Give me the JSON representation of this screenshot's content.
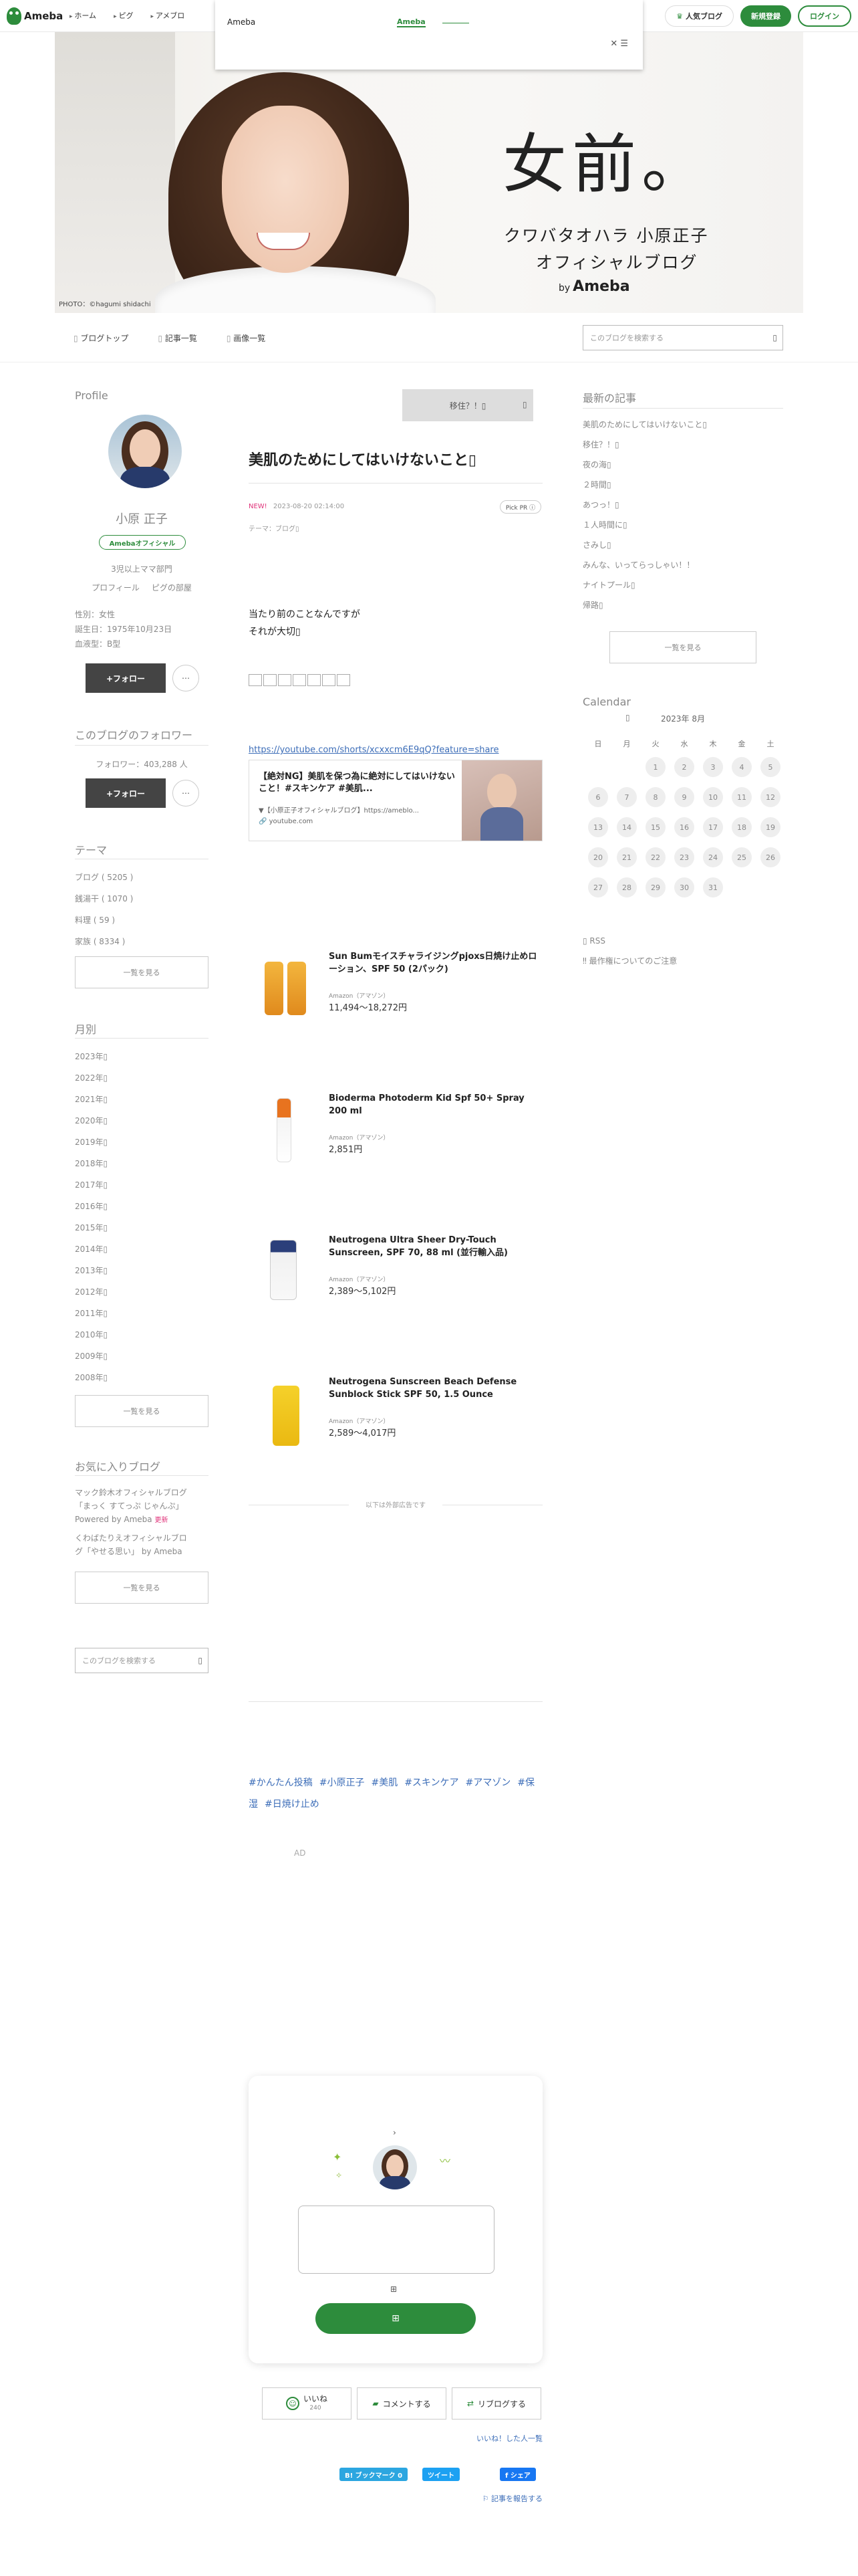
{
  "header": {
    "logo": "Ameba",
    "nav": [
      "ホーム",
      "ピグ",
      "アメブロ"
    ],
    "dropdown_brand": "Ameba",
    "dropdown_tab": "Ameba",
    "close_label": "✕ ☰",
    "popular_blog": "人気ブログ",
    "register": "新規登録",
    "login": "ログイン"
  },
  "hero": {
    "title": "女前。",
    "subtitle1": "クワバタオハラ 小原正子",
    "subtitle2": "オフィシャルブログ",
    "by": "by",
    "by_brand": "Ameba",
    "credit": "PHOTO：©hagumi shidachi"
  },
  "subnav": {
    "items": [
      "ブログトップ",
      "記事一覧",
      "画像一覧"
    ],
    "search_placeholder": "このブログを検索する"
  },
  "profile": {
    "heading": "Profile",
    "name": "小原 正子",
    "badge": "Amebaオフィシャル",
    "rank": "3児以上ママ部門",
    "links": [
      "プロフィール",
      "ピグの部屋"
    ],
    "details": [
      "性別：女性",
      "誕生日：1975年10月23日",
      "血液型：B型"
    ],
    "follow": "+フォロー",
    "dots": "⋯"
  },
  "followers": {
    "heading": "このブログのフォロワー",
    "count_text": "フォロワー：403,288 人",
    "follow": "+フォロー",
    "dots": "⋯"
  },
  "themes": {
    "heading": "テーマ",
    "items": [
      "ブログ ( 5205 )",
      "銭湯干 ( 1070 )",
      "料理 ( 59 )",
      "家族 ( 8334 )"
    ],
    "more": "一覧を見る"
  },
  "monthly": {
    "heading": "月別",
    "items": [
      "2023年▯",
      "2022年▯",
      "2021年▯",
      "2020年▯",
      "2019年▯",
      "2018年▯",
      "2017年▯",
      "2016年▯",
      "2015年▯",
      "2014年▯",
      "2013年▯",
      "2012年▯",
      "2011年▯",
      "2010年▯",
      "2009年▯",
      "2008年▯"
    ],
    "more": "一覧を見る"
  },
  "favorites": {
    "heading": "お気に入りブログ",
    "item1_line1": "マック鈴木オフィシャルブログ",
    "item1_line2": "「まっく すてっぷ じゃんぷ」",
    "item1_line3": "Powered by Ameba",
    "item1_new": "更新",
    "item2_line1": "くわばたりえオフィシャルブロ",
    "item2_line2": "グ「やせる思い」 by Ameba",
    "more": "一覧を見る",
    "search_placeholder": "このブログを検索する"
  },
  "article": {
    "next_label": "移住？！▯",
    "title": "美肌のためにしてはいけないこと▯",
    "new_badge": "NEW!",
    "date": "2023-08-20 02:14:00",
    "theme": "テーマ：ブログ▯",
    "pick": "Pick PR ⓘ",
    "body_line1": "当たり前のことなんですが",
    "body_line2": "それが大切▯",
    "link": "https://youtube.com/shorts/xcxxcm6E9qQ?feature=share",
    "embed_title": "【絶対NG】美肌を保つ為に絶対にしてはいけないこと！#スキンケア #美肌...",
    "embed_channel": "▼【小原正子オフィシャルブログ】https://ameblo...",
    "embed_domain": "🔗 youtube.com",
    "ads_label": "以下は外部広告です",
    "ad_text": "AD",
    "hashtags": [
      "#かんたん投稿",
      "#小原正子",
      "#美肌",
      "#スキンケア",
      "#アマゾン",
      "#保湿",
      "#日焼け止め"
    ]
  },
  "products": [
    {
      "name": "Sun Bumモイスチャライジングpjoxs日焼け止めローション、SPF 50 (2パック)",
      "shop": "Amazon（アマゾン）",
      "price": "11,494〜18,272円"
    },
    {
      "name": "Bioderma Photoderm Kid Spf 50+ Spray 200 ml",
      "shop": "Amazon（アマゾン）",
      "price": "2,851円"
    },
    {
      "name": "Neutrogena Ultra Sheer Dry-Touch Sunscreen, SPF 70, 88 ml (並行輸入品)",
      "shop": "Amazon（アマゾン）",
      "price": "2,389〜5,102円"
    },
    {
      "name": "Neutrogena Sunscreen Beach Defense Sunblock Stick SPF 50, 1.5 Ounce",
      "shop": "Amazon（アマゾン）",
      "price": "2,589〜4,017円"
    }
  ],
  "reactions": {
    "like": "いいね",
    "like_count": "240",
    "comment": "コメントする",
    "reblog": "リブログする",
    "liked_list": "いいね！した人一覧",
    "bookmark": "B! ブックマーク 0",
    "tweet": "ツイート",
    "fb_share": "f シェア",
    "report": "記事を報告する"
  },
  "recent": {
    "heading": "最新の記事",
    "items": [
      "美肌のためにしてはいけないこと▯",
      "移住？！▯",
      "夜の海▯",
      "２時間▯",
      "あつっ！▯",
      "１人時間に▯",
      "さみし▯",
      "みんな、いってらっしゃい！！",
      "ナイトプール▯",
      "帰路▯"
    ],
    "more": "一覧を見る"
  },
  "calendar": {
    "heading": "Calendar",
    "month": "2023年 8月",
    "weekdays": [
      "日",
      "月",
      "火",
      "水",
      "木",
      "金",
      "土"
    ],
    "weeks": [
      [
        "",
        "",
        "1",
        "2",
        "3",
        "4",
        "5"
      ],
      [
        "6",
        "7",
        "8",
        "9",
        "10",
        "11",
        "12"
      ],
      [
        "13",
        "14",
        "15",
        "16",
        "17",
        "18",
        "19"
      ],
      [
        "20",
        "21",
        "22",
        "23",
        "24",
        "25",
        "26"
      ],
      [
        "27",
        "28",
        "29",
        "30",
        "31",
        "",
        ""
      ]
    ],
    "rss": "RSS",
    "notice": "最作権についてのご注意"
  },
  "colors": {
    "brand_green": "#2d8c3c",
    "link_blue": "#3c6db8",
    "new_red": "#e0337a"
  }
}
